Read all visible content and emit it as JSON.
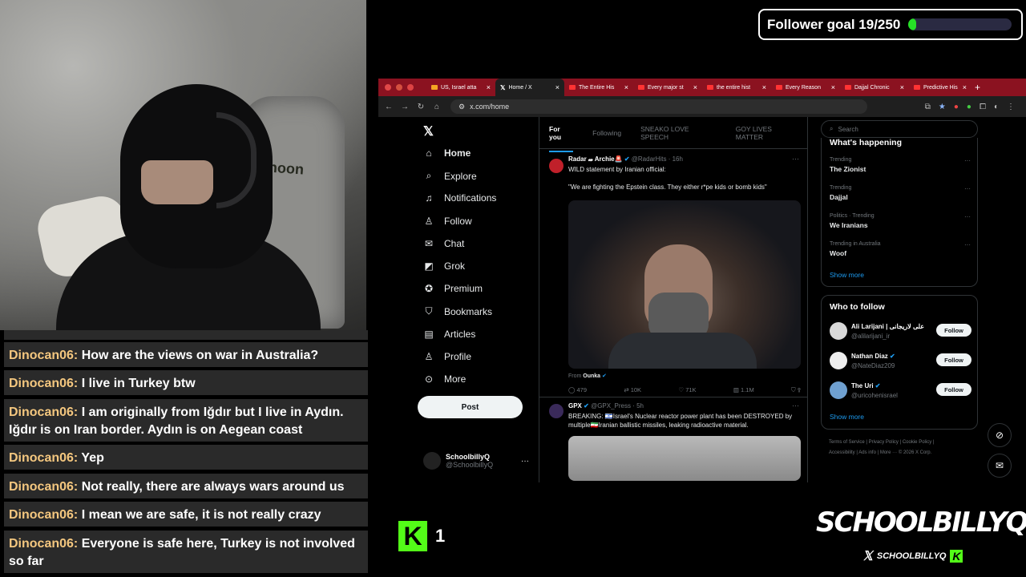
{
  "goal": {
    "label": "Follower goal 19/250",
    "current": 19,
    "target": 250
  },
  "chat": {
    "messages": [
      {
        "user": "Dinocan06:",
        "text": "How are the views on war in Australia?"
      },
      {
        "user": "Dinocan06:",
        "text": "I live in Turkey btw"
      },
      {
        "user": "Dinocan06:",
        "text": "I am originally from Iğdır but I live in Aydın. Iğdır is on Iran border. Aydın is on Aegean coast"
      },
      {
        "user": "Dinocan06:",
        "text": "Yep"
      },
      {
        "user": "Dinocan06:",
        "text": "Not really, there are always wars around us"
      },
      {
        "user": "Dinocan06:",
        "text": "I mean we are safe, it is not really crazy"
      },
      {
        "user": "Dinocan06:",
        "text": "Everyone is safe here, Turkey is not involved so far"
      }
    ]
  },
  "browser": {
    "tabs": [
      {
        "label": "US, Israel atta"
      },
      {
        "label": "Home / X"
      },
      {
        "label": "The Entire His"
      },
      {
        "label": "Every major st"
      },
      {
        "label": "the entire hist"
      },
      {
        "label": "Every Reason"
      },
      {
        "label": "Dajjal Chronic"
      },
      {
        "label": "Predictive His"
      }
    ],
    "url": "x.com/home"
  },
  "x_nav": {
    "items": [
      {
        "label": "Home",
        "icon": "home-icon"
      },
      {
        "label": "Explore",
        "icon": "search-icon"
      },
      {
        "label": "Notifications",
        "icon": "bell-icon"
      },
      {
        "label": "Follow",
        "icon": "person-add-icon"
      },
      {
        "label": "Chat",
        "icon": "mail-icon"
      },
      {
        "label": "Grok",
        "icon": "grok-icon"
      },
      {
        "label": "Premium",
        "icon": "verified-icon"
      },
      {
        "label": "Bookmarks",
        "icon": "bookmark-icon"
      },
      {
        "label": "Articles",
        "icon": "article-icon"
      },
      {
        "label": "Profile",
        "icon": "profile-icon"
      },
      {
        "label": "More",
        "icon": "more-icon"
      }
    ],
    "post_label": "Post",
    "profile_name": "SchoolbillyQ",
    "profile_handle": "@SchoolbillyQ"
  },
  "feed": {
    "tabs": [
      "For you",
      "Following",
      "SNEAKO LOVE SPEECH",
      "GOY LIVES MATTER"
    ],
    "tweets": [
      {
        "name": "Radar 𝔀 Archie🚨",
        "handle": "@RadarHits · 16h",
        "text1": "WILD statement by Iranian official:",
        "text2": "\"We are fighting the Epstein class. They either r*pe kids or bomb kids\"",
        "from_prefix": "From",
        "from": "Ounka",
        "replies": "479",
        "reposts": "10K",
        "likes": "71K",
        "views": "1.1M"
      },
      {
        "name": "GPX",
        "handle": "@GPX_Press · 5h",
        "text": "BREAKING: 🇮🇱Israel's Nuclear reactor power plant has been DESTROYED by multiple🇮🇷Iranian ballistic missiles, leaking radioactive material."
      }
    ]
  },
  "right": {
    "search_placeholder": "Search",
    "happening_title": "What's happening",
    "trends": [
      {
        "cat": "Trending",
        "name": "The Zionist"
      },
      {
        "cat": "Trending",
        "name": "Dajjal"
      },
      {
        "cat": "Politics · Trending",
        "name": "We Iranians"
      },
      {
        "cat": "Trending in Australia",
        "name": "Woof"
      }
    ],
    "show_more": "Show more",
    "wtf_title": "Who to follow",
    "follow_label": "Follow",
    "wtf": [
      {
        "name": "Ali Larijani | علی لاریجانی",
        "handle": "@alilarijani_ir"
      },
      {
        "name": "Nathan Diaz",
        "handle": "@NateDiaz209"
      },
      {
        "name": "The Uri",
        "handle": "@uricohenisrael"
      }
    ],
    "footer": [
      "Terms of Service",
      "Privacy Policy",
      "Cookie Policy",
      "Accessibility",
      "Ads info",
      "More ···",
      "© 2026 X Corp."
    ]
  },
  "overlay": {
    "kick_count": "1",
    "brand_big": "SCHOOLBILLYQ",
    "brand_small": "SCHOOLBILLYQ"
  },
  "colors": {
    "accent": "#1d9bf0",
    "kick": "#53fc18",
    "chat_user": "#f4c77f",
    "tabbar": "#8b1220"
  }
}
